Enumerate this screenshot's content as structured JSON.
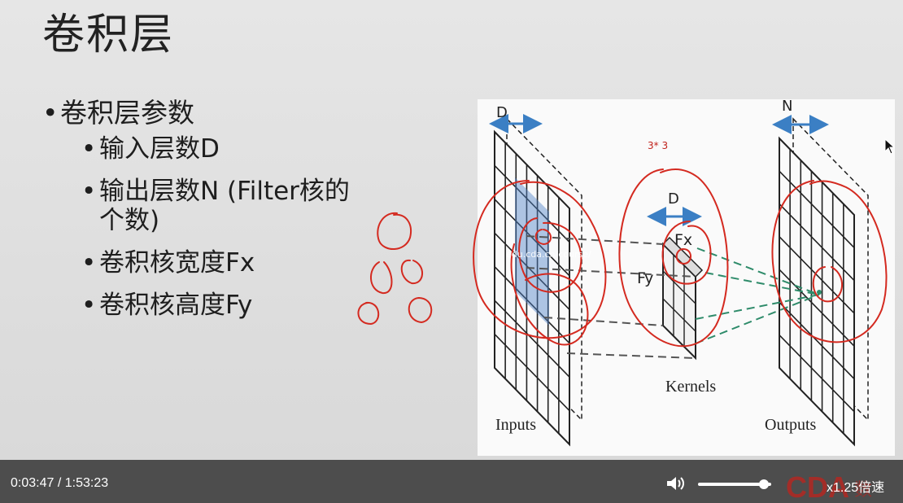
{
  "slide": {
    "title": "卷积层",
    "bullet_main": "卷积层参数",
    "sub_bullets": [
      "输入层数D",
      "输出层数N (Filter核的",
      "个数)",
      "卷积核宽度Fx",
      "卷积核高度Fy"
    ]
  },
  "figure": {
    "label_d_top": "D",
    "label_n_top": "N",
    "label_d_kernel": "D",
    "label_fx": "Fx",
    "label_fy": "Fy",
    "caption_inputs": "Inputs",
    "caption_kernels": "Kernels",
    "caption_outputs": "Outputs",
    "annotation_3x3": "3* 3",
    "watermark": "edu.cda.cn/course/"
  },
  "player": {
    "current_time": "0:03:47",
    "separator": "/",
    "total_time": "1:53:23",
    "speed_label": "x1.25倍速",
    "volume_level": 0.9
  },
  "colors": {
    "controls_bg": "#4d4d4d",
    "annotation_red": "#d42a20",
    "arrow_blue": "#3b7fc4",
    "dash_green": "#2e8b6a"
  }
}
